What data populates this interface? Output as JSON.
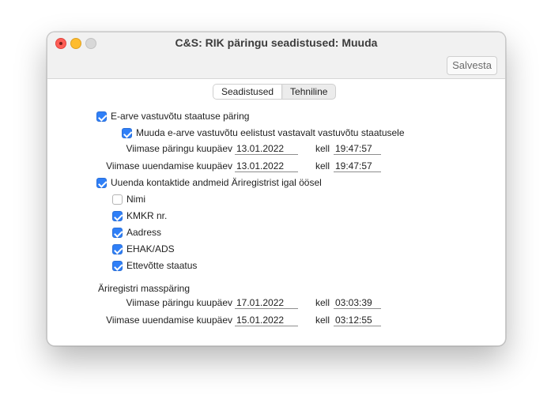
{
  "window": {
    "title": "C&S: RIK päringu seadistused: Muuda",
    "save_label": "Salvesta"
  },
  "tabs": [
    {
      "label": "Seadistused",
      "active": true
    },
    {
      "label": "Tehniline",
      "active": false
    }
  ],
  "einvoice": {
    "status_query": {
      "label": "E-arve vastuvõtu staatuse päring",
      "checked": true
    },
    "change_pref": {
      "label": "Muuda e-arve vastuvõtu eelistust vastavalt vastuvõtu staatusele",
      "checked": true
    },
    "last_query_label": "Viimase päringu kuupäev",
    "last_query_date": "13.01.2022",
    "last_query_time_label": "kell",
    "last_query_time": "19:47:57",
    "last_update_label": "Viimase uuendamise kuupäev",
    "last_update_date": "13.01.2022",
    "last_update_time_label": "kell",
    "last_update_time": "19:47:57"
  },
  "contacts": {
    "update_nightly": {
      "label": "Uuenda kontaktide andmeid Äriregistrist igal öösel",
      "checked": true
    },
    "options": [
      {
        "label": "Nimi",
        "checked": false
      },
      {
        "label": "KMKR nr.",
        "checked": true
      },
      {
        "label": "Aadress",
        "checked": true
      },
      {
        "label": "EHAK/ADS",
        "checked": true
      },
      {
        "label": "Ettevõtte staatus",
        "checked": true
      }
    ]
  },
  "mass_query": {
    "heading": "Äriregistri masspäring",
    "last_query_label": "Viimase päringu kuupäev",
    "last_query_date": "17.01.2022",
    "last_query_time_label": "kell",
    "last_query_time": "03:03:39",
    "last_update_label": "Viimase uuendamise kuupäev",
    "last_update_date": "15.01.2022",
    "last_update_time_label": "kell",
    "last_update_time": "03:12:55"
  },
  "colors": {
    "accent": "#2f7ff7",
    "close": "#ff5f57",
    "minimize": "#febc2e",
    "zoom": "#d8d8d8"
  }
}
